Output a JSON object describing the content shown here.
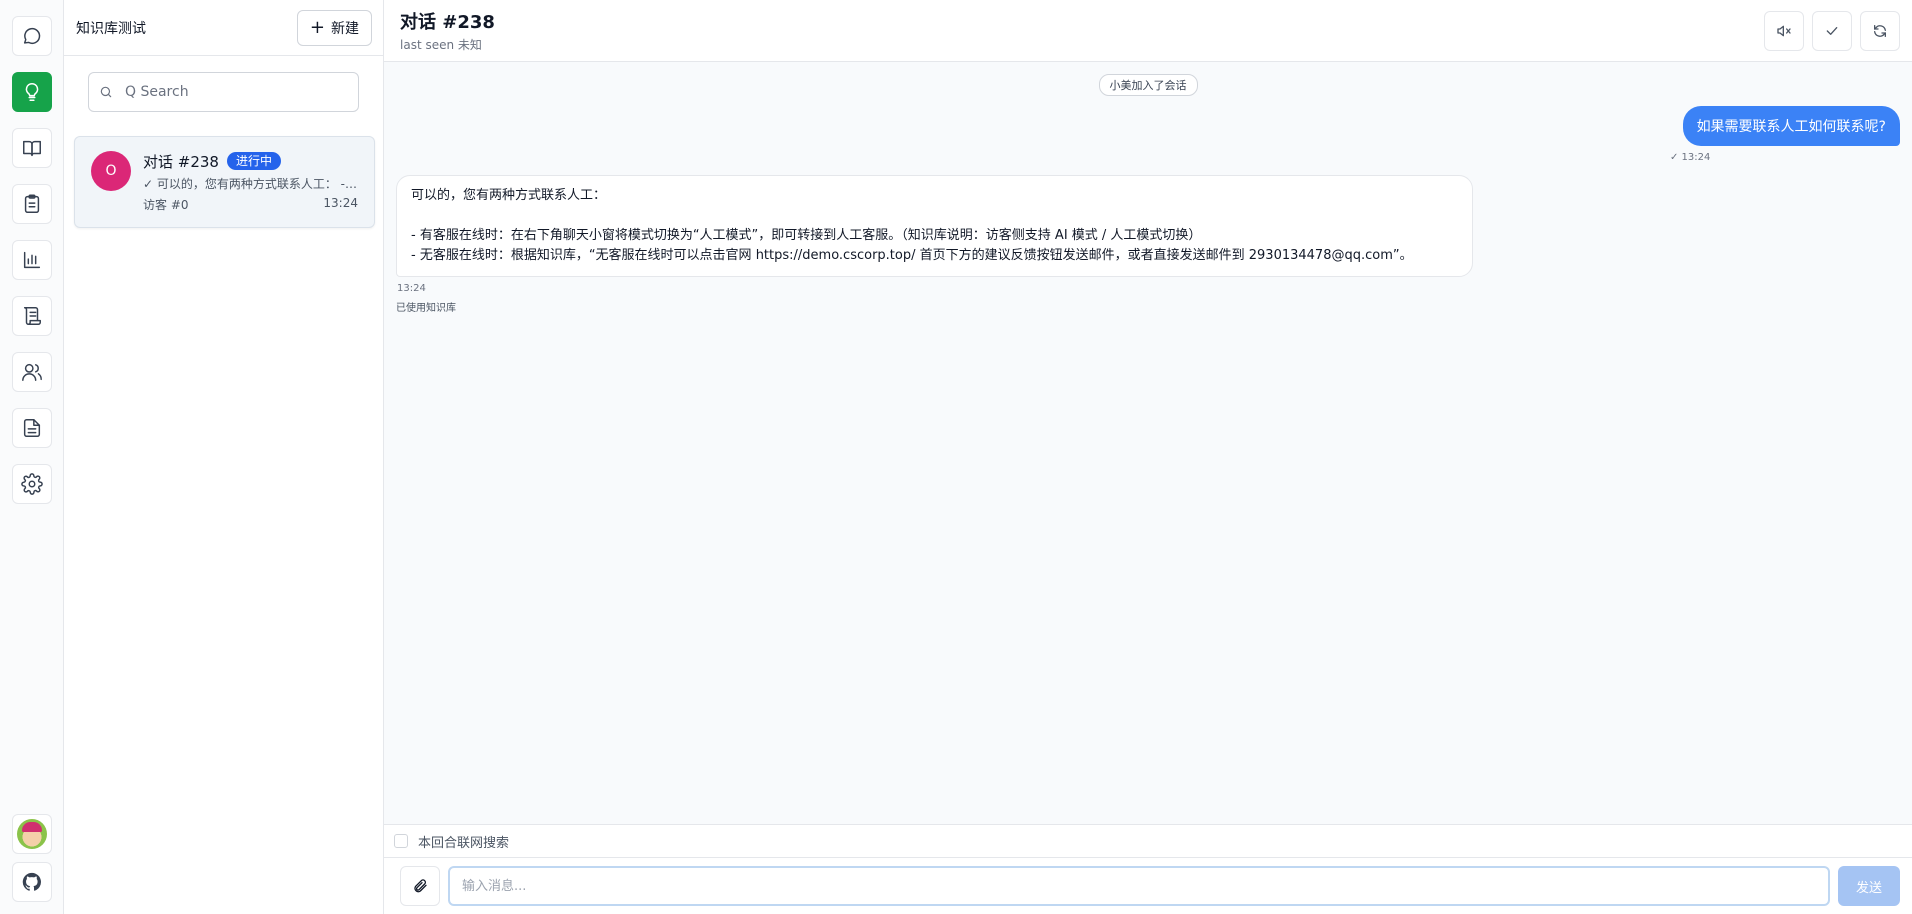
{
  "rail": {
    "items": [
      {
        "icon": "chat-bubble-icon",
        "active": false
      },
      {
        "icon": "lightbulb-icon",
        "active": true
      },
      {
        "icon": "book-icon",
        "active": false
      },
      {
        "icon": "clipboard-icon",
        "active": false
      },
      {
        "icon": "bar-chart-icon",
        "active": false
      },
      {
        "icon": "scroll-icon",
        "active": false
      },
      {
        "icon": "users-icon",
        "active": false
      },
      {
        "icon": "document-icon",
        "active": false
      },
      {
        "icon": "gear-icon",
        "active": false
      }
    ],
    "bottom": [
      "avatar",
      "github-icon"
    ],
    "accent": "#16a34a"
  },
  "list": {
    "title": "知识库测试",
    "new_label": "新建",
    "search_placeholder": "Q Search",
    "conversations": [
      {
        "avatar": "O",
        "name": "对话 #238",
        "badge": "进行中",
        "preview": "✓ 可以的，您有两种方式联系人工： - 有客服在线时：在右下角聊天小窗将模式切换为“人工模式”",
        "visitor": "访客 #0",
        "time": "13:24"
      }
    ]
  },
  "chat": {
    "title": "对话 #238",
    "subtitle": "last seen 未知",
    "system_notice": "小美加入了会话",
    "outgoing": {
      "text": "如果需要联系人工如何联系呢?",
      "time": "✓ 13:24"
    },
    "incoming": {
      "line1": "可以的，您有两种方式联系人工：",
      "line2": "- 有客服在线时：在右下角聊天小窗将模式切换为“人工模式”，即可转接到人工客服。（知识库说明：访客侧支持 AI 模式 / 人工模式切换）",
      "line3": "- 无客服在线时：根据知识库，“无客服在线时可以点击官网 https://demo.cscorp.top/ 首页下方的建议反馈按钮发送邮件，或者直接发送邮件到 2930134478@qq.com”。",
      "time": "13:24",
      "note": "已使用知识库"
    },
    "web_search_label": "本回合联网搜索",
    "input_placeholder": "输入消息...",
    "send_label": "发送",
    "colors": {
      "bubble_out": "#3b82f6",
      "badge": "#2563eb",
      "avatar": "#db2777"
    }
  }
}
